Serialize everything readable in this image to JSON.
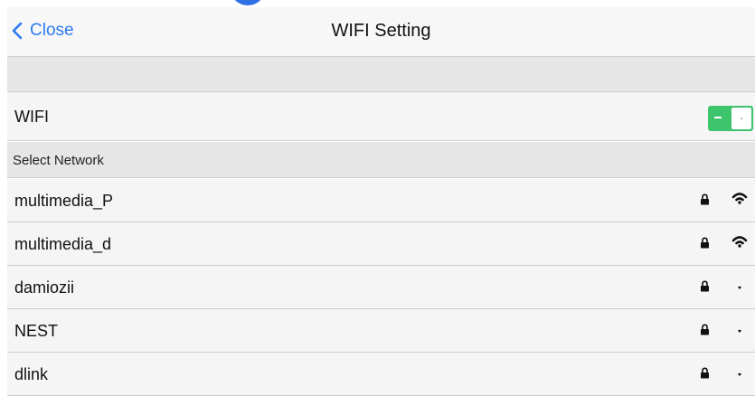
{
  "nav": {
    "back_label": "Close",
    "title": "WIFI Setting"
  },
  "wifi": {
    "label": "WIFI",
    "enabled": true
  },
  "section": {
    "header": "Select Network"
  },
  "networks": [
    {
      "name": "multimedia_P",
      "secured": true,
      "signal": "strong"
    },
    {
      "name": "multimedia_d",
      "secured": true,
      "signal": "strong"
    },
    {
      "name": "damiozii",
      "secured": true,
      "signal": "weak"
    },
    {
      "name": "NEST",
      "secured": true,
      "signal": "weak"
    },
    {
      "name": "dlink",
      "secured": true,
      "signal": "weak"
    }
  ],
  "colors": {
    "accent": "#2b7bf0",
    "toggle_on": "#3ec46d"
  },
  "icons": {
    "back": "chevron-left-icon",
    "lock": "lock-icon",
    "signal": "wifi-signal-icon"
  }
}
